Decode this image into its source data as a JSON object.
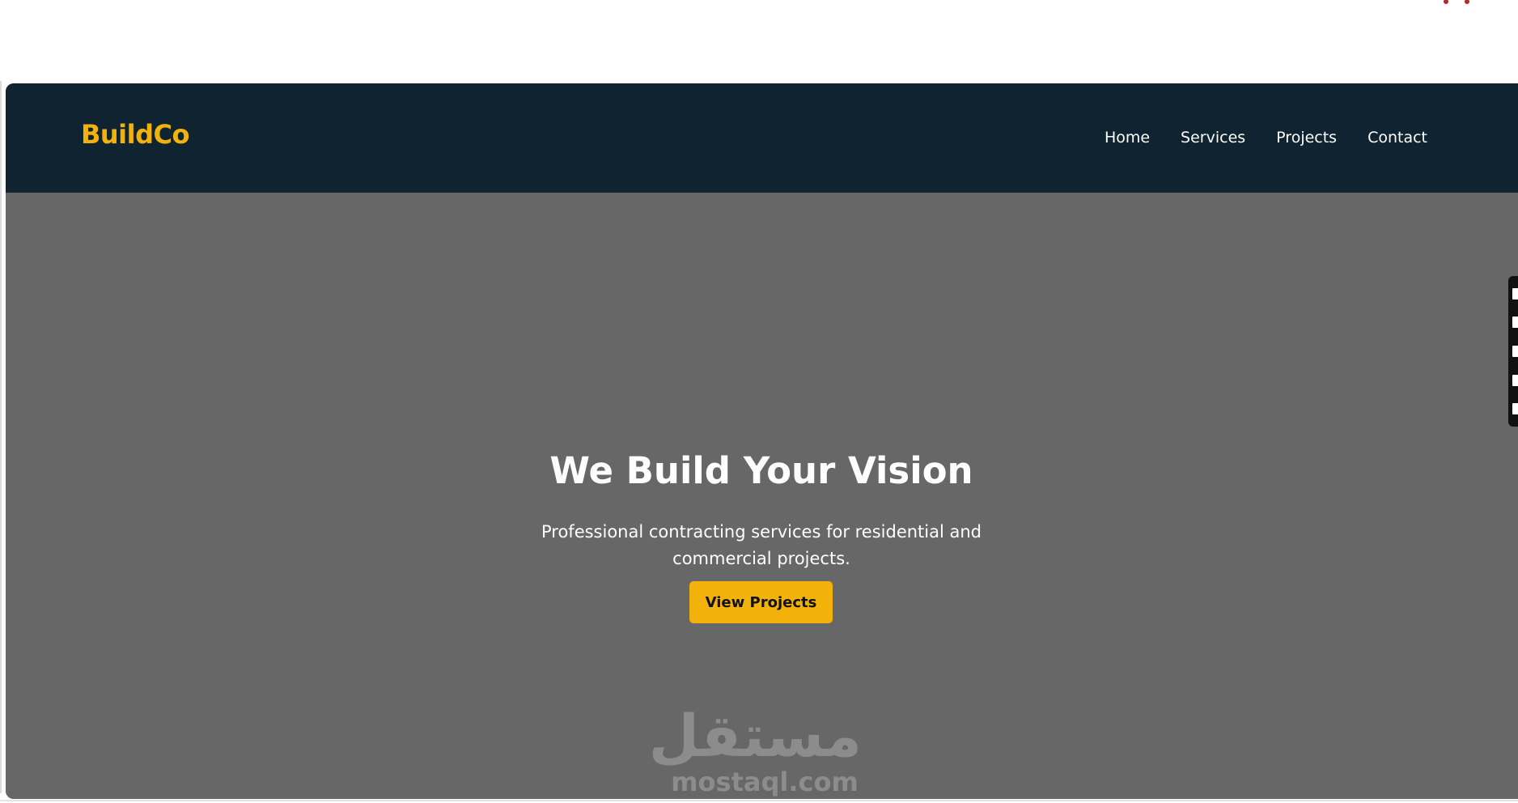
{
  "brand": {
    "name": "BuildCo",
    "accent_color": "#f2b20a",
    "nav_bg_color": "#0f2331",
    "hero_bg_color": "#676767"
  },
  "nav": {
    "links": [
      {
        "label": "Home"
      },
      {
        "label": "Services"
      },
      {
        "label": "Projects"
      },
      {
        "label": "Contact"
      }
    ]
  },
  "hero": {
    "title": "We Build Your Vision",
    "subtitle": "Professional contracting services for residential and commercial projects.",
    "cta_label": "View Projects"
  },
  "watermark": {
    "logo_text": "مستقل",
    "url_text": "mostaql.com"
  },
  "side_toolbar": {
    "icons": [
      "search-icon",
      "square-icon",
      "square-icon",
      "copy-icon",
      "settings-icon"
    ]
  }
}
